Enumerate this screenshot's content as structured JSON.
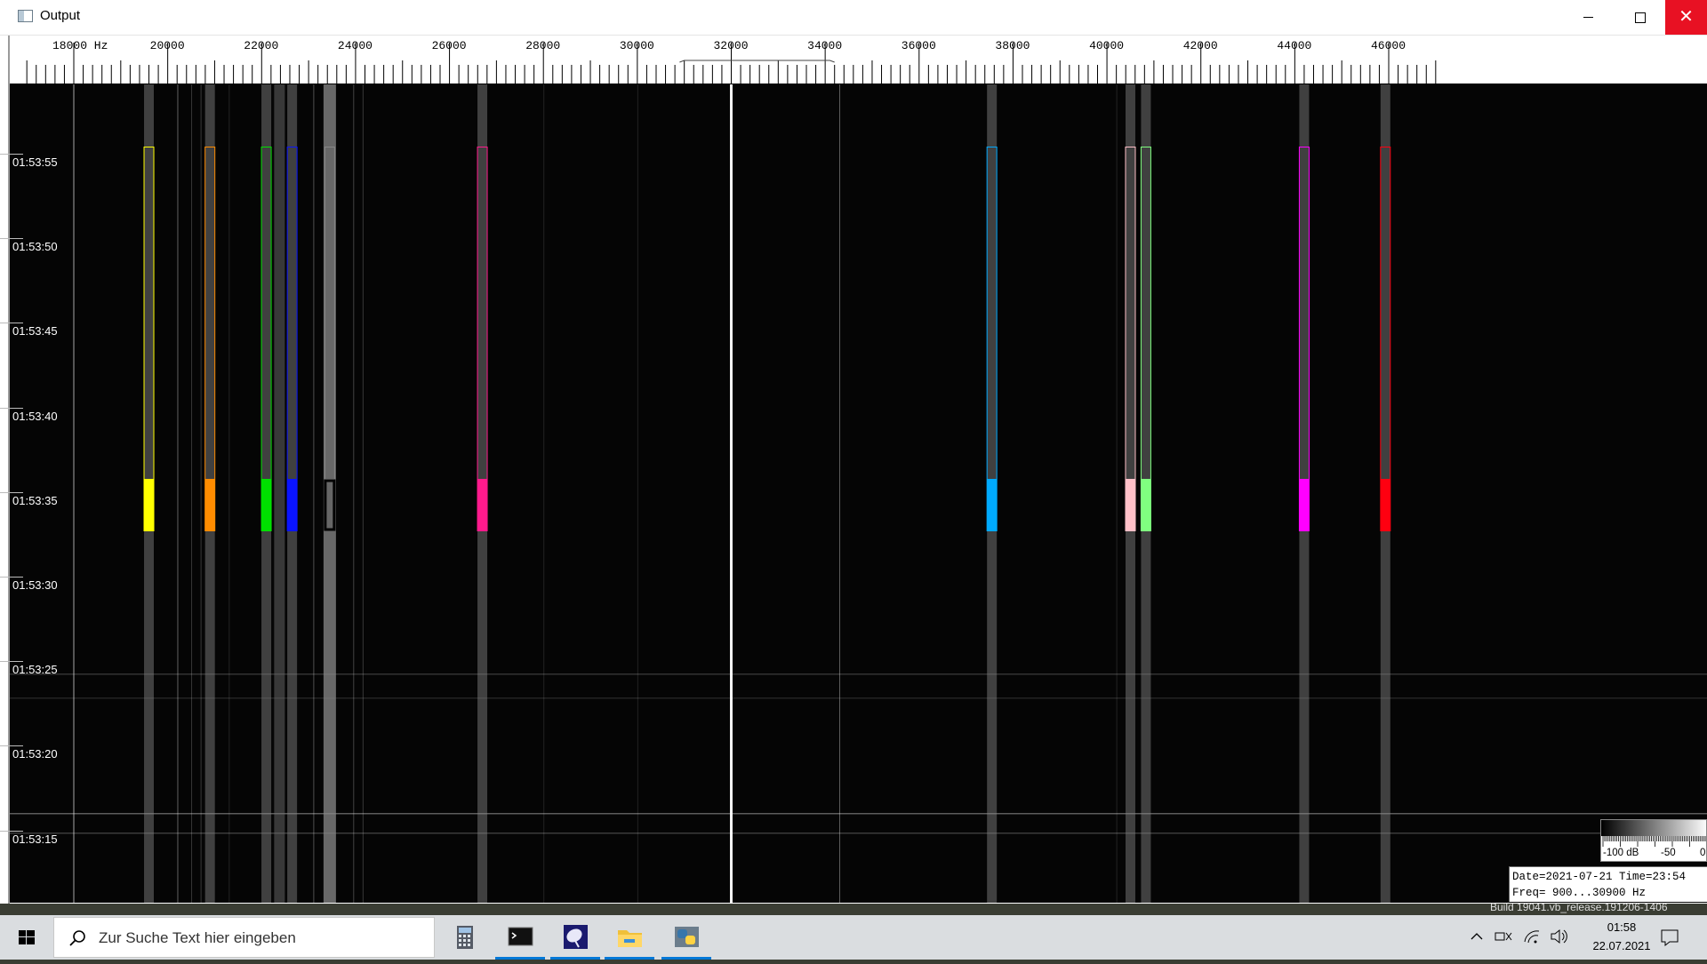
{
  "window": {
    "title": "Output"
  },
  "frequency_axis": {
    "unit": "Hz",
    "labels": [
      "18000 Hz",
      "20000",
      "22000",
      "24000",
      "26000",
      "28000",
      "30000",
      "32000",
      "34000",
      "36000",
      "38000",
      "40000",
      "42000",
      "44000",
      "46000"
    ]
  },
  "time_axis": {
    "labels": [
      "01:53:55",
      "01:53:50",
      "01:53:45",
      "01:53:40",
      "01:53:35",
      "01:53:30",
      "01:53:25",
      "01:53:20",
      "01:53:15"
    ]
  },
  "markers": [
    {
      "color": "#ffff00",
      "freq_hz": 19600
    },
    {
      "color": "#ff8c00",
      "freq_hz": 20900
    },
    {
      "color": "#00e000",
      "freq_hz": 22100
    },
    {
      "color": "#0a14ff",
      "freq_hz": 22650
    },
    {
      "color": "#888888",
      "freq_hz": 23450,
      "selected": true
    },
    {
      "color": "#ff1a8c",
      "freq_hz": 26700
    },
    {
      "color": "#00aaff",
      "freq_hz": 37550
    },
    {
      "color": "#ffc0c8",
      "freq_hz": 40500
    },
    {
      "color": "#80ff80",
      "freq_hz": 40830
    },
    {
      "color": "#ff00ff",
      "freq_hz": 44200
    },
    {
      "color": "#ff0010",
      "freq_hz": 45930
    }
  ],
  "db_scale": {
    "labels": [
      "-100 dB",
      "-50",
      "0"
    ]
  },
  "info": {
    "line1": "Date=2021-07-21 Time=23:54",
    "line2": "Freq= 900...30900 Hz"
  },
  "build": "Build 19041.vb_release.191206-1406",
  "taskbar": {
    "search_placeholder": "Zur Suche Text hier eingeben",
    "apps": [
      "calculator-app",
      "terminal-app",
      "sdr-app",
      "file-explorer-app",
      "python-app"
    ],
    "time": "01:58",
    "date": "22.07.2021"
  }
}
